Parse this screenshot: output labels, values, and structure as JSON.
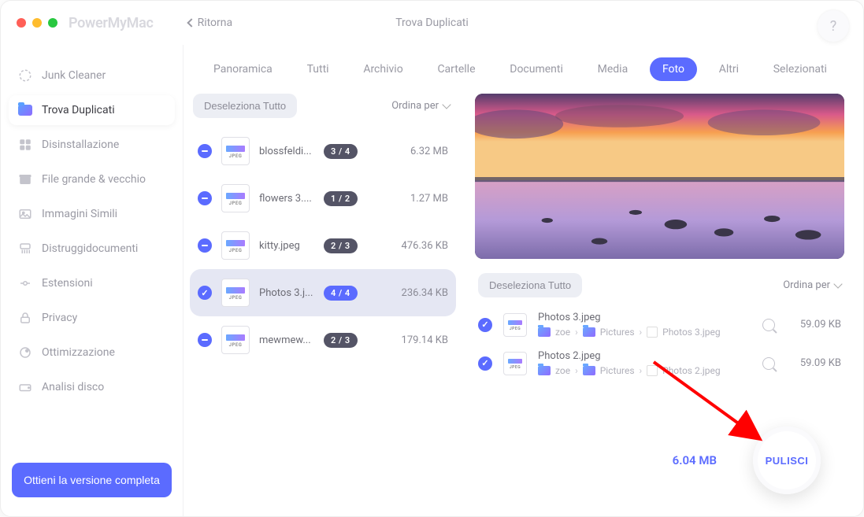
{
  "app_name": "PowerMyMac",
  "back_label": "Ritorna",
  "page_title": "Trova Duplicati",
  "help_symbol": "?",
  "sidebar": {
    "items": [
      {
        "label": "Junk Cleaner",
        "icon": "loader-icon"
      },
      {
        "label": "Trova Duplicati",
        "icon": "folder-icon",
        "active": true
      },
      {
        "label": "Disinstallazione",
        "icon": "apps-icon"
      },
      {
        "label": "File grande & vecchio",
        "icon": "box-icon"
      },
      {
        "label": "Immagini Simili",
        "icon": "image-icon"
      },
      {
        "label": "Distruggidocumenti",
        "icon": "shredder-icon"
      },
      {
        "label": "Estensioni",
        "icon": "plug-icon"
      },
      {
        "label": "Privacy",
        "icon": "lock-icon"
      },
      {
        "label": "Ottimizzazione",
        "icon": "rocket-icon"
      },
      {
        "label": "Analisi disco",
        "icon": "disk-icon"
      }
    ],
    "upgrade_label": "Ottieni la versione completa"
  },
  "tabs": [
    "Panoramica",
    "Tutti",
    "Archivio",
    "Cartelle",
    "Documenti",
    "Media",
    "Foto",
    "Altri",
    "Selezionati"
  ],
  "active_tab": "Foto",
  "list_toolbar": {
    "deselect_label": "Deseleziona Tutto",
    "sort_label": "Ordina per"
  },
  "files": [
    {
      "name": "blossfeldi...",
      "count": "3 / 4",
      "size": "6.32 MB",
      "check": "minus"
    },
    {
      "name": "flowers 3....",
      "count": "1 / 2",
      "size": "1.27 MB",
      "check": "minus"
    },
    {
      "name": "kitty.jpeg",
      "count": "2 / 3",
      "size": "476.36 KB",
      "check": "minus"
    },
    {
      "name": "Photos 3.j...",
      "count": "4 / 4",
      "size": "236.34 KB",
      "check": "ok",
      "selected": true
    },
    {
      "name": "mewmew...",
      "count": "2 / 3",
      "size": "179.14 KB",
      "check": "minus"
    }
  ],
  "dup_toolbar": {
    "deselect_label": "Deseleziona Tutto",
    "sort_label": "Ordina per"
  },
  "duplicates": [
    {
      "name": "Photos 3.jpeg",
      "path_user": "zoe",
      "path_folder": "Pictures",
      "path_file": "Photos 3.jpeg",
      "size": "59.09 KB"
    },
    {
      "name": "Photos 2.jpeg",
      "path_user": "zoe",
      "path_folder": "Pictures",
      "path_file": "Photos 2.jpeg",
      "size": "59.09 KB"
    }
  ],
  "total_size": "6.04 MB",
  "clean_label": "PULISCI",
  "thumb_label": "JPEG",
  "path_separator": "›"
}
